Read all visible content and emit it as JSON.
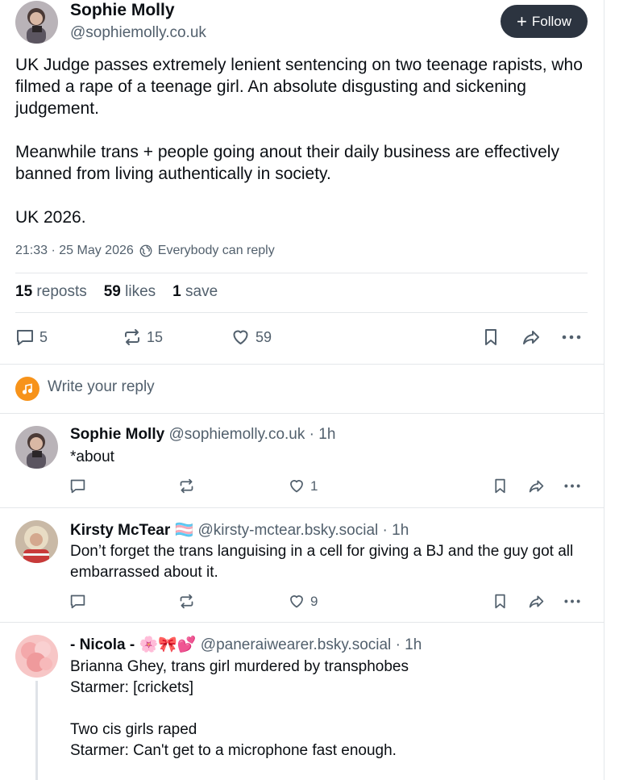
{
  "post": {
    "author": {
      "name": "Sophie Molly",
      "handle": "@sophiemolly.co.uk"
    },
    "follow_label": "Follow",
    "paragraphs": [
      "UK Judge passes extremely lenient sentencing on two teenage rapists, who filmed a rape of a teenage girl. An absolute disgusting and sickening judgement.",
      "Meanwhile trans + people going anout their daily business are effectively banned from living authentically in society.",
      "UK 2026."
    ],
    "timestamp": "21:33 · 25 May 2026",
    "reply_setting": "Everybody can reply",
    "stats": {
      "reposts_count": "15",
      "reposts_label": "reposts",
      "likes_count": "59",
      "likes_label": "likes",
      "saves_count": "1",
      "saves_label": "save"
    },
    "actions": {
      "replies": "5",
      "reposts": "15",
      "likes": "59"
    }
  },
  "compose": {
    "placeholder": "Write your reply"
  },
  "replies": [
    {
      "name": "Sophie Molly",
      "badges": "",
      "handle": "@sophiemolly.co.uk",
      "time": "· 1h",
      "lines": [
        "*about"
      ],
      "likes": "1"
    },
    {
      "name": "Kirsty McTear",
      "badges": "🏳️‍⚧️",
      "handle": "@kirsty-mctear.bsky.social",
      "time": "· 1h",
      "lines": [
        "Don’t forget the trans languising in a cell for giving a BJ and the guy got all embarrassed about it."
      ],
      "likes": "9"
    },
    {
      "name": "- Nicola -",
      "badges": "🌸🎀💕",
      "handle": "@paneraiwearer.bsky.social",
      "time": "· 1h",
      "lines": [
        "Brianna Ghey, trans girl murdered by transphobes",
        "Starmer: [crickets]",
        "",
        "Two cis girls raped",
        "Starmer: Can't get to a microphone fast enough."
      ]
    }
  ],
  "colors": {
    "follow_bg": "#2c3440",
    "secondary_text": "#52606d",
    "divider": "#e4e7ea",
    "compose_avatar": "#f7931a"
  }
}
